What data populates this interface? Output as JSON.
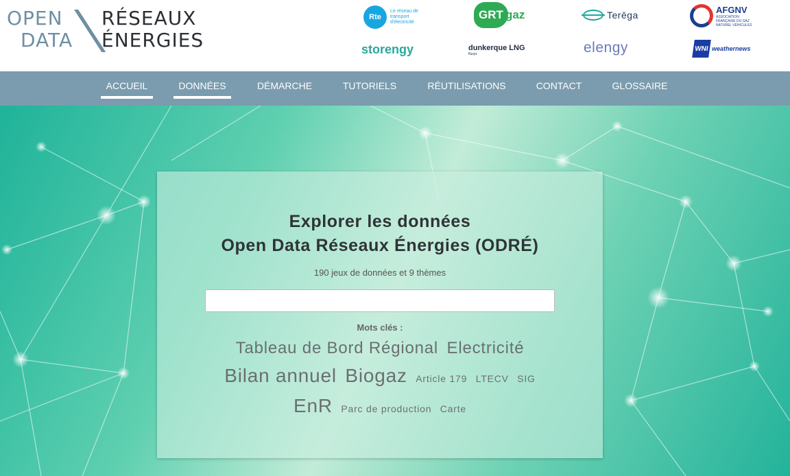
{
  "header": {
    "brand": {
      "line1_left": "OPEN",
      "line2_left": "DATA",
      "line1_right": "RÉSEAUX",
      "line2_right": "ÉNERGIES"
    },
    "partners": {
      "rte": {
        "mark": "Rte",
        "tagline": "Le réseau de transport d'électricité"
      },
      "grtgaz": {
        "mark": "GRT",
        "suffix": "gaz"
      },
      "terega": {
        "name": "Terēga"
      },
      "afgnv": {
        "name": "AFGNV",
        "tagline": "ASSOCIATION FRANÇAISE DU GAZ NATUREL VÉHICULES"
      },
      "storengy": {
        "name": "storengy"
      },
      "dunkerque": {
        "name": "dunkerque LNG",
        "tagline": "fluxys"
      },
      "elengy": {
        "name": "elengy"
      },
      "weathernews": {
        "mark": "WNI",
        "name": "weathernews"
      }
    }
  },
  "nav": {
    "items": [
      {
        "label": "ACCUEIL",
        "active": true
      },
      {
        "label": "DONNÉES",
        "active": true
      },
      {
        "label": "DÉMARCHE",
        "active": false
      },
      {
        "label": "TUTORIELS",
        "active": false
      },
      {
        "label": "RÉUTILISATIONS",
        "active": false
      },
      {
        "label": "CONTACT",
        "active": false
      },
      {
        "label": "GLOSSAIRE",
        "active": false
      }
    ]
  },
  "hero": {
    "title_line1": "Explorer les données",
    "title_line2": "Open Data Réseaux Énergies (ODRÉ)",
    "subtitle": "190 jeux de données et 9 thèmes",
    "search": {
      "value": "",
      "placeholder": ""
    },
    "keywords_label": "Mots clés :",
    "keywords": [
      {
        "label": "Tableau de Bord Régional"
      },
      {
        "label": "Electricité"
      },
      {
        "label": "Bilan annuel"
      },
      {
        "label": "Biogaz"
      },
      {
        "label": "Article 179"
      },
      {
        "label": "LTECV"
      },
      {
        "label": "SIG"
      },
      {
        "label": "EnR"
      },
      {
        "label": "Parc de production"
      },
      {
        "label": "Carte"
      }
    ]
  },
  "colors": {
    "nav_bg": "#7a9cae",
    "brand_grey_blue": "#6f8fa3",
    "hero_teal": "#1fb39a",
    "title_text": "#2f3336"
  }
}
